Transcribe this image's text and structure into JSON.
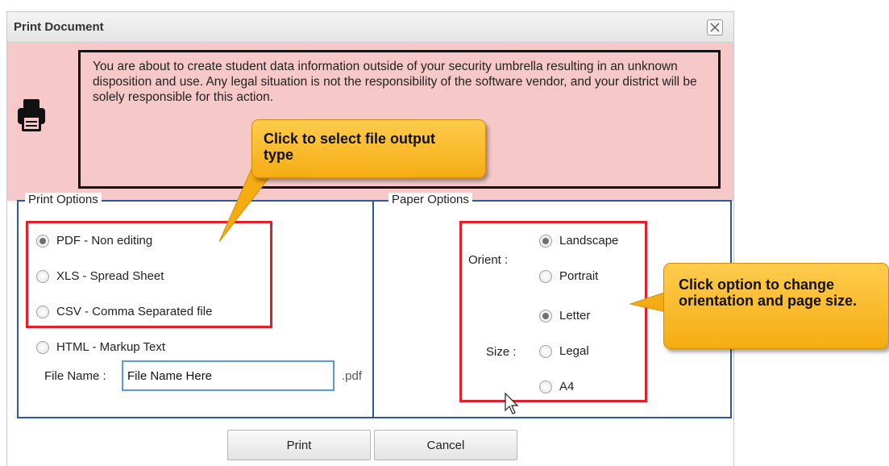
{
  "dialog": {
    "title": "Print Document",
    "close_icon": "close-icon"
  },
  "warning": {
    "icon": "printer-icon",
    "text": "You are about to create student data information outside of your security umbrella resulting in an unknown disposition and use. Any legal situation is not the responsibility of the software vendor, and your district will be solely responsible for this action."
  },
  "print_options": {
    "legend": "Print Options",
    "options": [
      {
        "label": "PDF - Non editing",
        "checked": true
      },
      {
        "label": "XLS - Spread Sheet",
        "checked": false
      },
      {
        "label": "CSV - Comma Separated file",
        "checked": false
      },
      {
        "label": "HTML - Markup Text",
        "checked": false
      }
    ],
    "file_name_label": "File Name :",
    "file_name_value": "File Name Here",
    "extension": ".pdf"
  },
  "paper_options": {
    "legend": "Paper Options",
    "orient_label": "Orient :",
    "orient_options": [
      {
        "label": "Landscape",
        "checked": true
      },
      {
        "label": "Portrait",
        "checked": false
      }
    ],
    "size_label": "Size :",
    "size_options": [
      {
        "label": "Letter",
        "checked": true
      },
      {
        "label": "Legal",
        "checked": false
      },
      {
        "label": "A4",
        "checked": false
      }
    ]
  },
  "buttons": {
    "print": "Print",
    "cancel": "Cancel"
  },
  "callouts": {
    "file_type": "Click to select file output type",
    "paper": "Click option to change orientation and page size."
  },
  "colors": {
    "warning_bg": "#f6c8c8",
    "panel_border": "#2a5b96",
    "highlight": "#e0202a",
    "callout": "#f5ac12"
  }
}
